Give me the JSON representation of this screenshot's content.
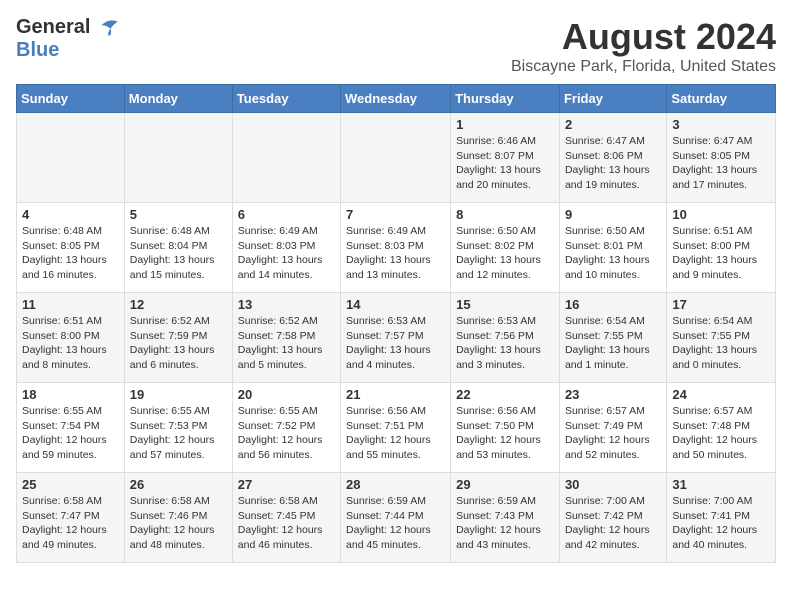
{
  "logo": {
    "general": "General",
    "blue": "Blue"
  },
  "title": {
    "month": "August 2024",
    "location": "Biscayne Park, Florida, United States"
  },
  "header": {
    "days": [
      "Sunday",
      "Monday",
      "Tuesday",
      "Wednesday",
      "Thursday",
      "Friday",
      "Saturday"
    ]
  },
  "weeks": [
    {
      "days": [
        {
          "number": "",
          "info": ""
        },
        {
          "number": "",
          "info": ""
        },
        {
          "number": "",
          "info": ""
        },
        {
          "number": "",
          "info": ""
        },
        {
          "number": "1",
          "info": "Sunrise: 6:46 AM\nSunset: 8:07 PM\nDaylight: 13 hours\nand 20 minutes."
        },
        {
          "number": "2",
          "info": "Sunrise: 6:47 AM\nSunset: 8:06 PM\nDaylight: 13 hours\nand 19 minutes."
        },
        {
          "number": "3",
          "info": "Sunrise: 6:47 AM\nSunset: 8:05 PM\nDaylight: 13 hours\nand 17 minutes."
        }
      ]
    },
    {
      "days": [
        {
          "number": "4",
          "info": "Sunrise: 6:48 AM\nSunset: 8:05 PM\nDaylight: 13 hours\nand 16 minutes."
        },
        {
          "number": "5",
          "info": "Sunrise: 6:48 AM\nSunset: 8:04 PM\nDaylight: 13 hours\nand 15 minutes."
        },
        {
          "number": "6",
          "info": "Sunrise: 6:49 AM\nSunset: 8:03 PM\nDaylight: 13 hours\nand 14 minutes."
        },
        {
          "number": "7",
          "info": "Sunrise: 6:49 AM\nSunset: 8:03 PM\nDaylight: 13 hours\nand 13 minutes."
        },
        {
          "number": "8",
          "info": "Sunrise: 6:50 AM\nSunset: 8:02 PM\nDaylight: 13 hours\nand 12 minutes."
        },
        {
          "number": "9",
          "info": "Sunrise: 6:50 AM\nSunset: 8:01 PM\nDaylight: 13 hours\nand 10 minutes."
        },
        {
          "number": "10",
          "info": "Sunrise: 6:51 AM\nSunset: 8:00 PM\nDaylight: 13 hours\nand 9 minutes."
        }
      ]
    },
    {
      "days": [
        {
          "number": "11",
          "info": "Sunrise: 6:51 AM\nSunset: 8:00 PM\nDaylight: 13 hours\nand 8 minutes."
        },
        {
          "number": "12",
          "info": "Sunrise: 6:52 AM\nSunset: 7:59 PM\nDaylight: 13 hours\nand 6 minutes."
        },
        {
          "number": "13",
          "info": "Sunrise: 6:52 AM\nSunset: 7:58 PM\nDaylight: 13 hours\nand 5 minutes."
        },
        {
          "number": "14",
          "info": "Sunrise: 6:53 AM\nSunset: 7:57 PM\nDaylight: 13 hours\nand 4 minutes."
        },
        {
          "number": "15",
          "info": "Sunrise: 6:53 AM\nSunset: 7:56 PM\nDaylight: 13 hours\nand 3 minutes."
        },
        {
          "number": "16",
          "info": "Sunrise: 6:54 AM\nSunset: 7:55 PM\nDaylight: 13 hours\nand 1 minute."
        },
        {
          "number": "17",
          "info": "Sunrise: 6:54 AM\nSunset: 7:55 PM\nDaylight: 13 hours\nand 0 minutes."
        }
      ]
    },
    {
      "days": [
        {
          "number": "18",
          "info": "Sunrise: 6:55 AM\nSunset: 7:54 PM\nDaylight: 12 hours\nand 59 minutes."
        },
        {
          "number": "19",
          "info": "Sunrise: 6:55 AM\nSunset: 7:53 PM\nDaylight: 12 hours\nand 57 minutes."
        },
        {
          "number": "20",
          "info": "Sunrise: 6:55 AM\nSunset: 7:52 PM\nDaylight: 12 hours\nand 56 minutes."
        },
        {
          "number": "21",
          "info": "Sunrise: 6:56 AM\nSunset: 7:51 PM\nDaylight: 12 hours\nand 55 minutes."
        },
        {
          "number": "22",
          "info": "Sunrise: 6:56 AM\nSunset: 7:50 PM\nDaylight: 12 hours\nand 53 minutes."
        },
        {
          "number": "23",
          "info": "Sunrise: 6:57 AM\nSunset: 7:49 PM\nDaylight: 12 hours\nand 52 minutes."
        },
        {
          "number": "24",
          "info": "Sunrise: 6:57 AM\nSunset: 7:48 PM\nDaylight: 12 hours\nand 50 minutes."
        }
      ]
    },
    {
      "days": [
        {
          "number": "25",
          "info": "Sunrise: 6:58 AM\nSunset: 7:47 PM\nDaylight: 12 hours\nand 49 minutes."
        },
        {
          "number": "26",
          "info": "Sunrise: 6:58 AM\nSunset: 7:46 PM\nDaylight: 12 hours\nand 48 minutes."
        },
        {
          "number": "27",
          "info": "Sunrise: 6:58 AM\nSunset: 7:45 PM\nDaylight: 12 hours\nand 46 minutes."
        },
        {
          "number": "28",
          "info": "Sunrise: 6:59 AM\nSunset: 7:44 PM\nDaylight: 12 hours\nand 45 minutes."
        },
        {
          "number": "29",
          "info": "Sunrise: 6:59 AM\nSunset: 7:43 PM\nDaylight: 12 hours\nand 43 minutes."
        },
        {
          "number": "30",
          "info": "Sunrise: 7:00 AM\nSunset: 7:42 PM\nDaylight: 12 hours\nand 42 minutes."
        },
        {
          "number": "31",
          "info": "Sunrise: 7:00 AM\nSunset: 7:41 PM\nDaylight: 12 hours\nand 40 minutes."
        }
      ]
    }
  ]
}
